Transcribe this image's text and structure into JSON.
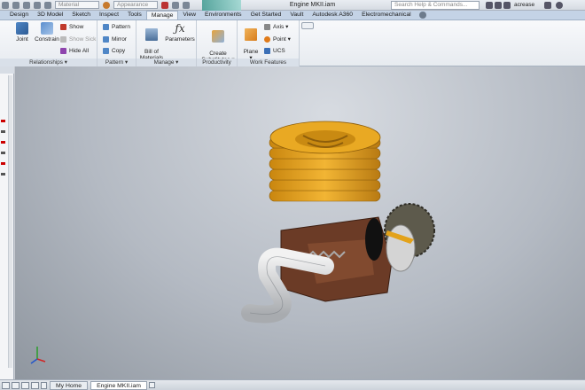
{
  "qat": {
    "material": "Material",
    "appearance": "Appearance",
    "title": "Engine MKII.iam",
    "search_placeholder": "Search Help & Commands...",
    "user": "acrease"
  },
  "tabs": [
    "Design",
    "3D Model",
    "Sketch",
    "Inspect",
    "Tools",
    "Manage",
    "View",
    "Environments",
    "Get Started",
    "Vault",
    "Autodesk A360",
    "Electromechanical"
  ],
  "ribbon": {
    "relationships": {
      "title": "Relationships ▾",
      "joint": "Joint",
      "constrain": "Constrain",
      "show": "Show",
      "show_sick": "Show Sick",
      "hide_all": "Hide All"
    },
    "pattern": {
      "title": "Pattern ▾",
      "pattern": "Pattern",
      "mirror": "Mirror",
      "copy": "Copy"
    },
    "manage": {
      "title": "Manage ▾",
      "bom": "Bill of\nMaterials",
      "parameters": "Parameters"
    },
    "productivity": {
      "title": "Productivity",
      "create_substitutes": "Create\nSubstitutes ▾"
    },
    "work_features": {
      "title": "Work Features",
      "plane": "Plane\n▾",
      "axis": "Axis ▾",
      "point": "Point ▾",
      "ucs": "UCS"
    }
  },
  "status": {
    "home_tab": "My Home",
    "doc_tab": "Engine MKII.iam"
  },
  "colors": {
    "fins": "#e3a21a",
    "crankcase": "#6b3b26",
    "exhaust": "#d9dadc",
    "accent": "#3f9a90"
  }
}
